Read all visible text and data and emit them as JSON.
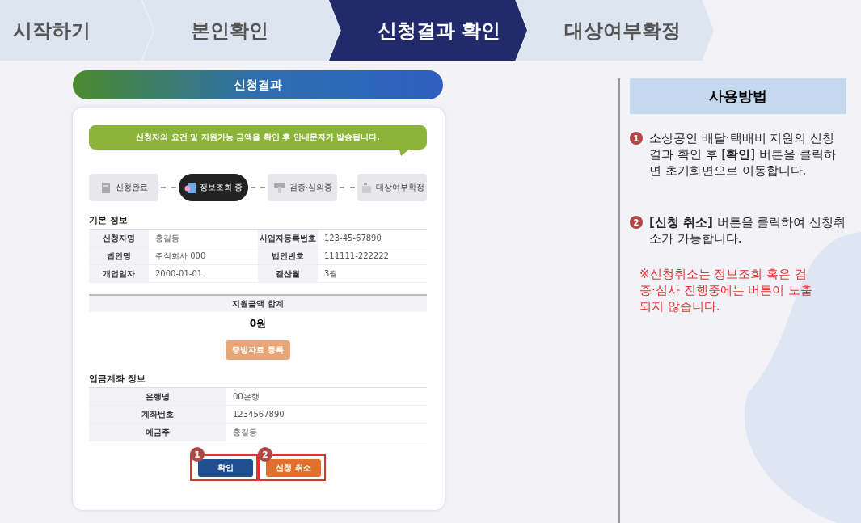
{
  "steps": [
    {
      "label": "시작하기",
      "selected": false
    },
    {
      "label": "본인확인",
      "selected": false
    },
    {
      "label": "신청결과 확인",
      "selected": true
    },
    {
      "label": "대상여부확정",
      "selected": false
    }
  ],
  "result": {
    "title": "신청결과",
    "notice": "신청자의 요건 및 지원가능 금액을 확인 후 안내문자가 발송됩니다.",
    "progress": [
      {
        "label": "신청완료",
        "kind": "doc",
        "selected": false
      },
      {
        "label": "정보조회 중",
        "kind": "search",
        "selected": true
      },
      {
        "label": "검증·심의중",
        "kind": "hand",
        "selected": false
      },
      {
        "label": "대상여부확정",
        "kind": "box",
        "selected": false
      }
    ],
    "basic_title": "기본 정보",
    "basic_rows": [
      [
        {
          "label": "신청자명",
          "value": "홍길동"
        },
        {
          "label": "사업자등록번호",
          "value": "123-45-67890"
        }
      ],
      [
        {
          "label": "법인명",
          "value": "주식회사 000"
        },
        {
          "label": "법인번호",
          "value": "111111-222222"
        }
      ],
      [
        {
          "label": "개업일자",
          "value": "2000-01-01"
        },
        {
          "label": "결산월",
          "value": "3월"
        }
      ]
    ],
    "total_label": "지원금액 합계",
    "total_value": "0원",
    "evidence_button": "증빙자료 등록",
    "account_title": "입금계좌 정보",
    "account_rows": [
      {
        "label": "은행명",
        "value": "00은행"
      },
      {
        "label": "계좌번호",
        "value": "1234567890"
      },
      {
        "label": "예금주",
        "value": "홍길동"
      }
    ],
    "buttons": [
      {
        "label": "확인",
        "kind": "primary",
        "badge": "1"
      },
      {
        "label": "신청 취소",
        "kind": "cancel",
        "badge": "2"
      }
    ]
  },
  "guide": {
    "title": "사용방법",
    "items": [
      {
        "badge": "1",
        "text": "소상공인 배달·택배비 지원의 신청결과 확인 후 [**확인**] 버튼을 클릭하면 초기화면으로 이동합니다."
      },
      {
        "badge": "2",
        "text": "**[신청 취소]** 버튼을 클릭하여 신청취소가 가능합니다.",
        "note": "※신청취소는 정보조회 혹은 검증·심사 진행중에는 버튼이 노출되지 않습니다."
      }
    ]
  }
}
